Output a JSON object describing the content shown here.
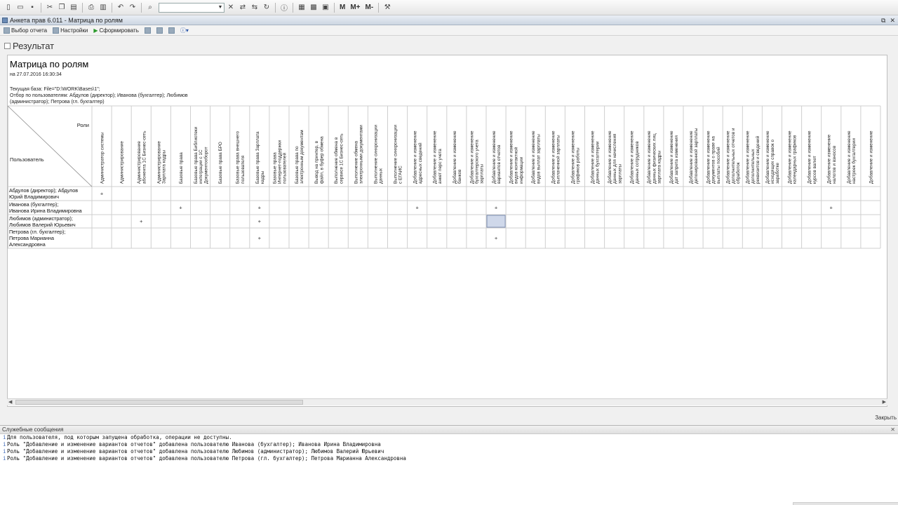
{
  "window": {
    "title": "Анкета прав 6.011 - Матрица по ролям"
  },
  "toolbar": {
    "icons": [
      "new-icon",
      "open-icon",
      "save-icon",
      "cut-icon",
      "copy-icon",
      "paste-icon",
      "print-icon",
      "preview-icon",
      "undo-icon",
      "redo-icon",
      "find-icon"
    ],
    "memory_buttons": [
      "M",
      "M+",
      "M-"
    ]
  },
  "commands": {
    "select_report": "Выбор отчета",
    "settings": "Настройки",
    "generate": "Сформировать"
  },
  "result_title": "Результат",
  "report": {
    "title": "Матрица по ролям",
    "date_line": "на 27.07.2016 16:30:34",
    "base_line": "Текущая база: File=\"D:\\WORK\\Bases\\1\";",
    "filter_line_1": "Отбор по пользователям: Абдулов (директор); Иванова (бухгалтер); Любимов",
    "filter_line_2": "(администратор); Петрова (гл. бухгалтер)",
    "corner_roles": "Роли",
    "corner_user": "Пользователь",
    "columns": [
      "Администратор системы",
      "Администрирование",
      "Администрирование абонента 1С Бизнес-сеть",
      "Администрирование Зарплата кадры",
      "Базовые права",
      "Базовые права Библиотеки интеграции с 1С Документооборот",
      "Базовые права БРО",
      "Базовые права внешнего пользователя",
      "Базовые права Зарплата кадры",
      "Базовые права Интернет-поддержки пользователей",
      "Базовые права по электронным документам",
      "Вывод на принтер, в файл, в буфер обмена",
      "Выполнение обмена в сервисе 1С Бизнес-сеть",
      "Выполнение обмена электронными документами",
      "Выполнение синхронизации данных",
      "Выполнение синхронизации с ЕГАИС",
      "Добавление и изменение адресных сведений",
      "Добавление и изменение анкет перс учета",
      "Добавление и изменение банков",
      "Добавление и изменение бухгалтерского учета зарплаты",
      "Добавление и изменение вариантов отчетов",
      "Добавление и изменение видов контактной информации",
      "Добавление и изменение видов выплат зарплаты",
      "Добавление и изменение выплаченной зарплаты",
      "Добавление и изменение графиков работы",
      "Добавление и изменение данных бухгалтерии",
      "Добавление и изменение данных для начисления зарплаты",
      "Добавление и изменение данных сотрудников",
      "Добавление и изменение данных физических лиц зарплата кадры",
      "Добавление и изменение дат запрета изменения",
      "Добавление и изменение депонированной зарплаты",
      "Добавление и изменение документов о праве на выплаты пособий социального страхования",
      "Добавление и изменение дополнительных отчетов и обработок",
      "Добавление и изменение дополнительных реквизитов и сведений",
      "Добавление и изменение исходящих справок о заработке",
      "Добавление и изменение календарных графиков",
      "Добавление и изменение курсов валют",
      "Добавление изменение налогов и взносов",
      "Добавление и изменение настроек бухгалтерии",
      "Добавление и изменение"
    ],
    "rows": [
      {
        "user": "Абдулов (директор); Абдулов Юрий Владимирович",
        "marks": [
          0
        ]
      },
      {
        "user": "Иванова (бухгалтер); Иванова Ирина Владимировна",
        "marks": [
          4,
          8,
          16,
          20,
          37
        ]
      },
      {
        "user": "Любимов (администратор); Любимов Валерий Юрьевич",
        "marks": [
          2,
          8
        ]
      },
      {
        "user": "Петрова (гл. бухгалтер); Петрова Марианна Александровна",
        "marks": [
          8,
          20
        ]
      }
    ],
    "mark_symbol": "+",
    "selected_cell": {
      "row": 2,
      "col": 20
    }
  },
  "footer": {
    "close_label": "Закрыть"
  },
  "messages": {
    "title": "Служебные сообщения",
    "lines": [
      "Для пользователя, под которым запущена обработка, операции не доступны.",
      "Роль \"Добавление и изменение вариантов отчетов\" добавлена пользователю Иванова (бухгалтер); Иванова Ирина Владимировна",
      "Роль \"Добавление и изменение вариантов отчетов\" добавлена пользователю Любимов (администратор); Любимов Валерий Юрьевич",
      "Роль \"Добавление и изменение вариантов отчетов\" добавлена пользователю Петрова (гл. бухгалтер); Петрова Марианна Александровна"
    ]
  },
  "colors": {
    "selected_cell": "#cfd8ea",
    "grid": "#cfcfcf",
    "accent": "#3a66b8"
  }
}
